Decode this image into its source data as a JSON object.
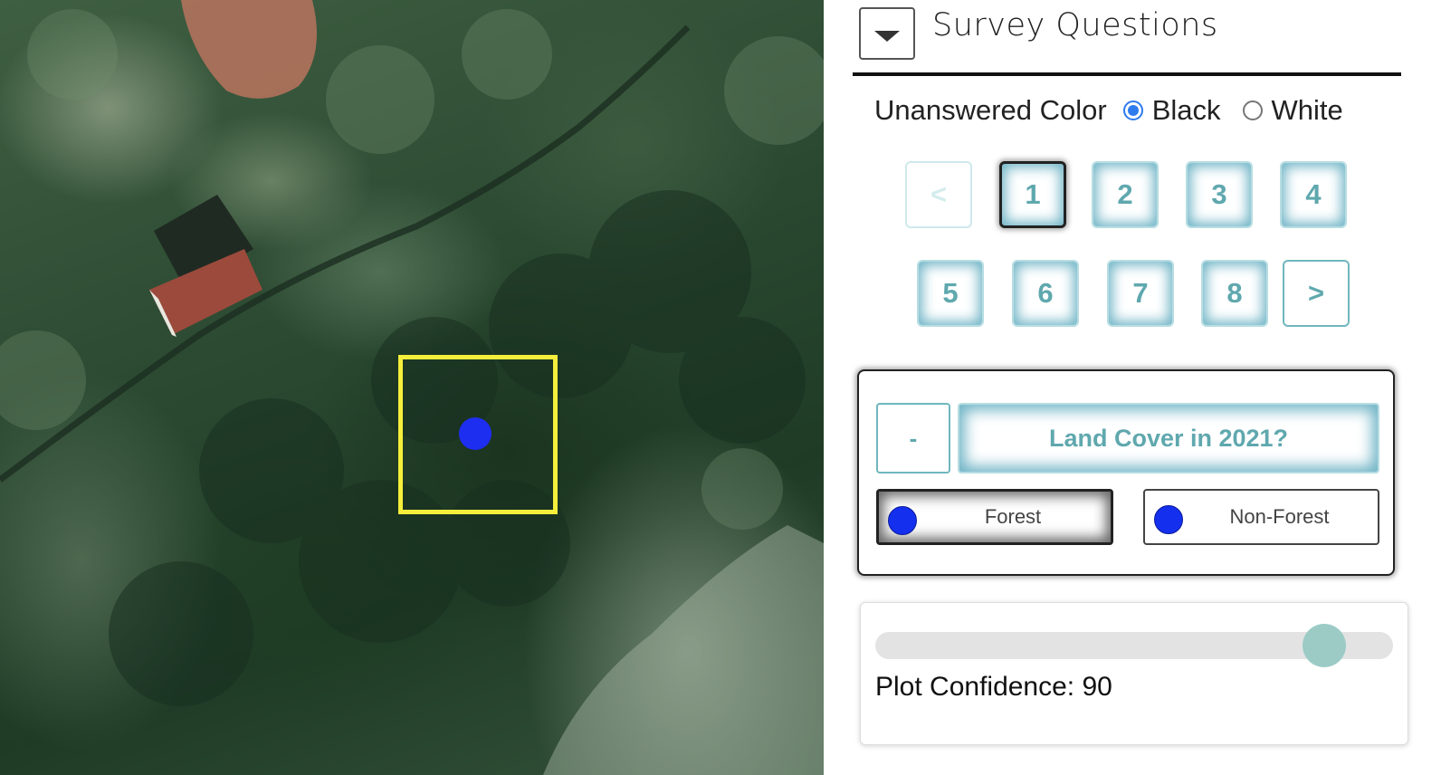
{
  "map": {
    "plot_box_color": "#f5ee3b",
    "sample_point_color": "#1e2ef0"
  },
  "panel": {
    "title": "Survey Questions",
    "collapse_icon": "caret-down-icon",
    "unanswered_color": {
      "label": "Unanswered Color",
      "options": [
        "Black",
        "White"
      ],
      "selected": "Black"
    },
    "pagination": {
      "prev_label": "<",
      "next_label": ">",
      "pages": [
        "1",
        "2",
        "3",
        "4",
        "5",
        "6",
        "7",
        "8"
      ],
      "current": "1",
      "accent": "#5fa8ae"
    },
    "question": {
      "collapse_label": "-",
      "title": "Land Cover in 2021?",
      "answers": [
        {
          "label": "Forest",
          "color": "#1430ee",
          "selected": true
        },
        {
          "label": "Non-Forest",
          "color": "#1430ee",
          "selected": false
        }
      ]
    },
    "confidence": {
      "label": "Plot Confidence: 90",
      "value": 90,
      "max": 100
    }
  }
}
